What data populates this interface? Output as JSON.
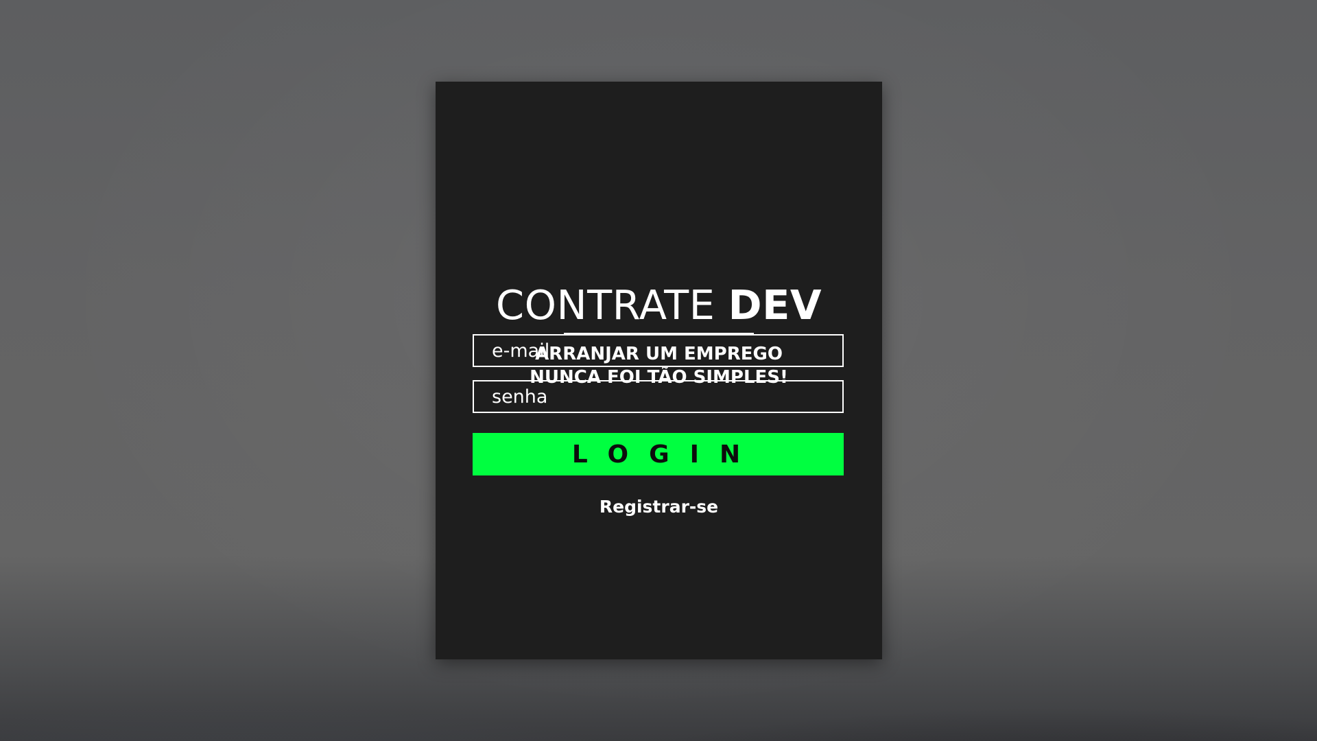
{
  "brand": {
    "title_light": "CONTRATE ",
    "title_bold": "DEV"
  },
  "tagline": {
    "line1": "ARRANJAR UM EMPREGO",
    "line2": "NUNCA FOI TÃO SIMPLES!"
  },
  "form": {
    "email_placeholder": "e-mail",
    "email_value": "",
    "password_placeholder": "senha",
    "password_value": "",
    "login_label": "LOGIN",
    "register_label": "Registrar-se"
  },
  "colors": {
    "card_background": "#1e1e1e",
    "accent": "#00ff40",
    "text": "#ffffff"
  }
}
